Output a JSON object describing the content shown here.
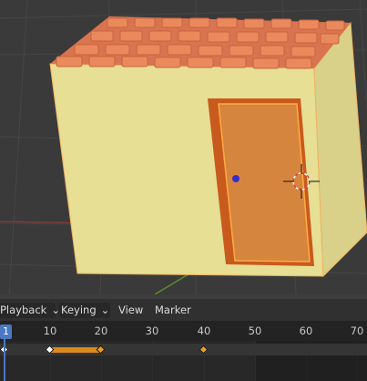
{
  "app": "Blender",
  "viewport": {
    "description_colors": {
      "wall": "#e6df94",
      "roof_tile": "#e07a52",
      "door": "#d6853e",
      "door_frame": "#c95a1e",
      "selection_outline": "#ffaa40",
      "door_knob": "#3a2ccc"
    }
  },
  "timeline_header": {
    "menus": [
      {
        "label": "Playback",
        "dropdown": true
      },
      {
        "label": "Keying",
        "dropdown": true
      },
      {
        "label": "View",
        "dropdown": false
      },
      {
        "label": "Marker",
        "dropdown": false
      }
    ]
  },
  "timeline": {
    "current_frame": "1",
    "frame_labels": [
      "10",
      "20",
      "30",
      "40",
      "50",
      "60",
      "70"
    ],
    "keyframes": [
      1,
      10,
      20,
      40
    ],
    "held_range": [
      10,
      20
    ],
    "colors": {
      "selected_key": "#ffffff",
      "key": "#e8a020",
      "playhead": "#4a78c2"
    }
  }
}
